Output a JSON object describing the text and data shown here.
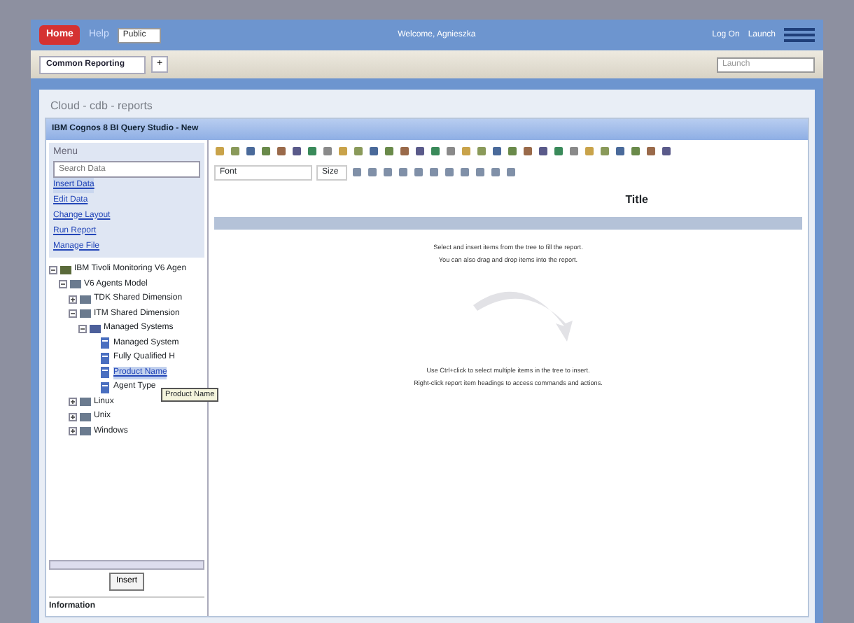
{
  "top_bar": {
    "home": "Home",
    "help": "Help",
    "folder_select": "Public",
    "title": "Welcome, Agnieszka",
    "links": [
      "Log On",
      "Launch"
    ]
  },
  "tab_bar": {
    "tab": "Common Reporting",
    "add": "+",
    "launch_select": "Launch"
  },
  "breadcrumb": "Cloud - cdb - reports",
  "window": {
    "title": "IBM Cognos 8 BI Query Studio - New"
  },
  "menu": {
    "title": "Menu",
    "search": {
      "placeholder": "Search Data"
    },
    "items": [
      {
        "label": "Insert Data",
        "selected": true
      },
      {
        "label": "Edit Data",
        "selected": false
      },
      {
        "label": "Change Layout",
        "selected": false
      },
      {
        "label": "Run Report",
        "selected": false
      },
      {
        "label": "Manage File",
        "selected": false
      }
    ]
  },
  "tree": [
    {
      "label": "IBM Tivoli Monitoring V6 Agen",
      "kind": "package",
      "expanded": true,
      "selected": false,
      "children": [
        {
          "label": "V6 Agents Model",
          "kind": "namespace",
          "expanded": true,
          "selected": false,
          "children": [
            {
              "label": "TDK Shared Dimension",
              "kind": "namespace",
              "expanded": false,
              "selected": false
            },
            {
              "label": "ITM Shared Dimension",
              "kind": "namespace",
              "expanded": true,
              "selected": false,
              "children": [
                {
                  "label": "Managed Systems",
                  "kind": "folder",
                  "expanded": true,
                  "selected": false,
                  "children": [
                    {
                      "label": "Managed System",
                      "kind": "item",
                      "selected": false
                    },
                    {
                      "label": "Fully Qualified H",
                      "kind": "item",
                      "selected": false
                    },
                    {
                      "label": "Product Name",
                      "kind": "item",
                      "selected": true
                    },
                    {
                      "label": "Agent Type",
                      "kind": "item",
                      "selected": false
                    }
                  ]
                }
              ]
            },
            {
              "label": "Linux",
              "kind": "namespace",
              "expanded": false,
              "selected": false
            },
            {
              "label": "Unix",
              "kind": "namespace",
              "expanded": false,
              "selected": false
            },
            {
              "label": "Windows",
              "kind": "namespace",
              "expanded": false,
              "selected": false
            }
          ]
        }
      ]
    }
  ],
  "tooltip": "Product Name",
  "insert_button": "Insert",
  "info_title": "Information",
  "format_bar": {
    "font": "Font",
    "size": "Size"
  },
  "report": {
    "title": "Title",
    "hints": [
      "Select and insert items from the tree to fill the report.",
      "You can also drag and drop items into the report.",
      "Use Ctrl+click to select multiple items in the tree to insert.",
      "Right-click report item headings to access commands and actions."
    ]
  }
}
